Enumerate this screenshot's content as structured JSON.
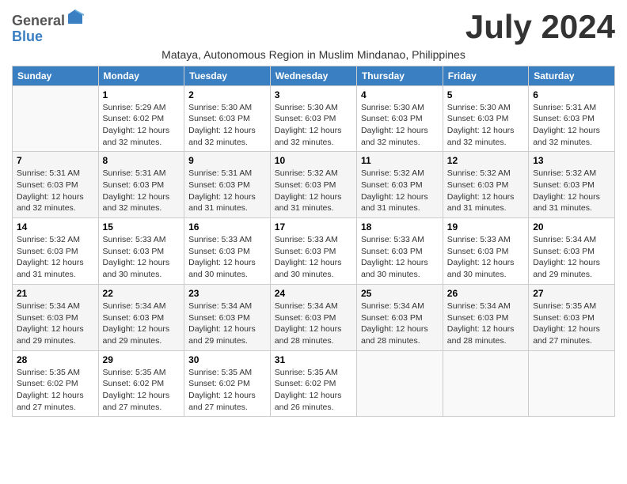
{
  "logo": {
    "general": "General",
    "blue": "Blue"
  },
  "title": "July 2024",
  "subtitle": "Mataya, Autonomous Region in Muslim Mindanao, Philippines",
  "days_header": [
    "Sunday",
    "Monday",
    "Tuesday",
    "Wednesday",
    "Thursday",
    "Friday",
    "Saturday"
  ],
  "weeks": [
    [
      {
        "num": "",
        "info": ""
      },
      {
        "num": "1",
        "info": "Sunrise: 5:29 AM\nSunset: 6:02 PM\nDaylight: 12 hours\nand 32 minutes."
      },
      {
        "num": "2",
        "info": "Sunrise: 5:30 AM\nSunset: 6:03 PM\nDaylight: 12 hours\nand 32 minutes."
      },
      {
        "num": "3",
        "info": "Sunrise: 5:30 AM\nSunset: 6:03 PM\nDaylight: 12 hours\nand 32 minutes."
      },
      {
        "num": "4",
        "info": "Sunrise: 5:30 AM\nSunset: 6:03 PM\nDaylight: 12 hours\nand 32 minutes."
      },
      {
        "num": "5",
        "info": "Sunrise: 5:30 AM\nSunset: 6:03 PM\nDaylight: 12 hours\nand 32 minutes."
      },
      {
        "num": "6",
        "info": "Sunrise: 5:31 AM\nSunset: 6:03 PM\nDaylight: 12 hours\nand 32 minutes."
      }
    ],
    [
      {
        "num": "7",
        "info": "Sunrise: 5:31 AM\nSunset: 6:03 PM\nDaylight: 12 hours\nand 32 minutes."
      },
      {
        "num": "8",
        "info": "Sunrise: 5:31 AM\nSunset: 6:03 PM\nDaylight: 12 hours\nand 32 minutes."
      },
      {
        "num": "9",
        "info": "Sunrise: 5:31 AM\nSunset: 6:03 PM\nDaylight: 12 hours\nand 31 minutes."
      },
      {
        "num": "10",
        "info": "Sunrise: 5:32 AM\nSunset: 6:03 PM\nDaylight: 12 hours\nand 31 minutes."
      },
      {
        "num": "11",
        "info": "Sunrise: 5:32 AM\nSunset: 6:03 PM\nDaylight: 12 hours\nand 31 minutes."
      },
      {
        "num": "12",
        "info": "Sunrise: 5:32 AM\nSunset: 6:03 PM\nDaylight: 12 hours\nand 31 minutes."
      },
      {
        "num": "13",
        "info": "Sunrise: 5:32 AM\nSunset: 6:03 PM\nDaylight: 12 hours\nand 31 minutes."
      }
    ],
    [
      {
        "num": "14",
        "info": "Sunrise: 5:32 AM\nSunset: 6:03 PM\nDaylight: 12 hours\nand 31 minutes."
      },
      {
        "num": "15",
        "info": "Sunrise: 5:33 AM\nSunset: 6:03 PM\nDaylight: 12 hours\nand 30 minutes."
      },
      {
        "num": "16",
        "info": "Sunrise: 5:33 AM\nSunset: 6:03 PM\nDaylight: 12 hours\nand 30 minutes."
      },
      {
        "num": "17",
        "info": "Sunrise: 5:33 AM\nSunset: 6:03 PM\nDaylight: 12 hours\nand 30 minutes."
      },
      {
        "num": "18",
        "info": "Sunrise: 5:33 AM\nSunset: 6:03 PM\nDaylight: 12 hours\nand 30 minutes."
      },
      {
        "num": "19",
        "info": "Sunrise: 5:33 AM\nSunset: 6:03 PM\nDaylight: 12 hours\nand 30 minutes."
      },
      {
        "num": "20",
        "info": "Sunrise: 5:34 AM\nSunset: 6:03 PM\nDaylight: 12 hours\nand 29 minutes."
      }
    ],
    [
      {
        "num": "21",
        "info": "Sunrise: 5:34 AM\nSunset: 6:03 PM\nDaylight: 12 hours\nand 29 minutes."
      },
      {
        "num": "22",
        "info": "Sunrise: 5:34 AM\nSunset: 6:03 PM\nDaylight: 12 hours\nand 29 minutes."
      },
      {
        "num": "23",
        "info": "Sunrise: 5:34 AM\nSunset: 6:03 PM\nDaylight: 12 hours\nand 29 minutes."
      },
      {
        "num": "24",
        "info": "Sunrise: 5:34 AM\nSunset: 6:03 PM\nDaylight: 12 hours\nand 28 minutes."
      },
      {
        "num": "25",
        "info": "Sunrise: 5:34 AM\nSunset: 6:03 PM\nDaylight: 12 hours\nand 28 minutes."
      },
      {
        "num": "26",
        "info": "Sunrise: 5:34 AM\nSunset: 6:03 PM\nDaylight: 12 hours\nand 28 minutes."
      },
      {
        "num": "27",
        "info": "Sunrise: 5:35 AM\nSunset: 6:03 PM\nDaylight: 12 hours\nand 27 minutes."
      }
    ],
    [
      {
        "num": "28",
        "info": "Sunrise: 5:35 AM\nSunset: 6:02 PM\nDaylight: 12 hours\nand 27 minutes."
      },
      {
        "num": "29",
        "info": "Sunrise: 5:35 AM\nSunset: 6:02 PM\nDaylight: 12 hours\nand 27 minutes."
      },
      {
        "num": "30",
        "info": "Sunrise: 5:35 AM\nSunset: 6:02 PM\nDaylight: 12 hours\nand 27 minutes."
      },
      {
        "num": "31",
        "info": "Sunrise: 5:35 AM\nSunset: 6:02 PM\nDaylight: 12 hours\nand 26 minutes."
      },
      {
        "num": "",
        "info": ""
      },
      {
        "num": "",
        "info": ""
      },
      {
        "num": "",
        "info": ""
      }
    ]
  ]
}
